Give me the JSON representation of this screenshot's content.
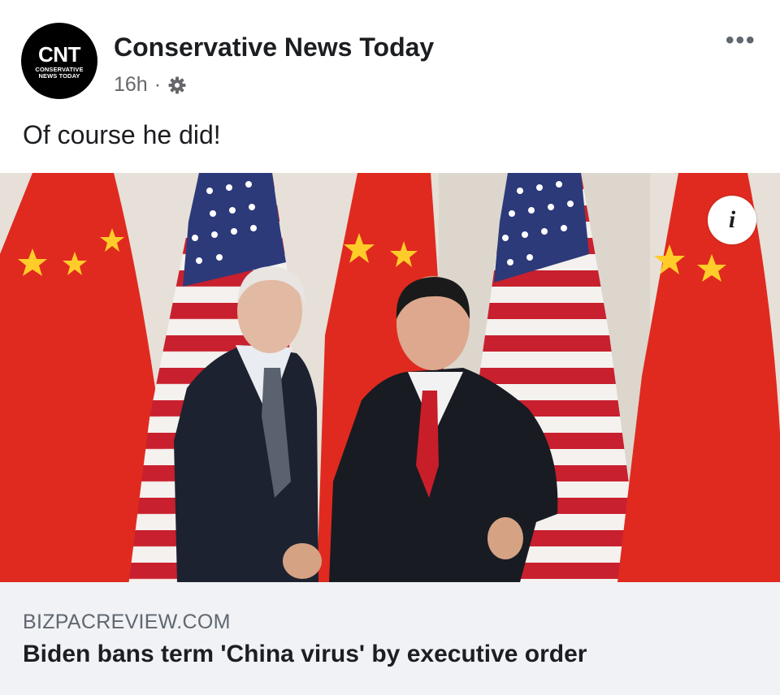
{
  "post": {
    "page_name": "Conservative News Today",
    "avatar": {
      "monogram": "CNT",
      "subtitle_line1": "CONSERVATIVE",
      "subtitle_line2": "NEWS TODAY"
    },
    "timestamp": "16h",
    "separator": "·",
    "audience_icon": "gear-icon",
    "more_icon": "more-options-icon",
    "text": "Of course he did!"
  },
  "link_preview": {
    "info_icon_label": "i",
    "domain": "BIZPACREVIEW.COM",
    "title": "Biden bans term 'China virus' by executive order"
  },
  "colors": {
    "china_flag_red": "#e02a1f",
    "china_star": "#ffcc29",
    "us_blue": "#2c3a7a",
    "us_red": "#c8202e",
    "link_card_bg": "#f0f2f5",
    "meta_gray": "#65676b"
  }
}
